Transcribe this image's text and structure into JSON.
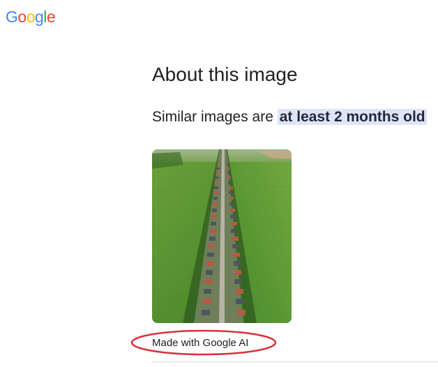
{
  "logo": {
    "letters": [
      {
        "char": "G",
        "color": "#4285F4"
      },
      {
        "char": "o",
        "color": "#EA4335"
      },
      {
        "char": "o",
        "color": "#FBBC05"
      },
      {
        "char": "g",
        "color": "#4285F4"
      },
      {
        "char": "l",
        "color": "#34A853"
      },
      {
        "char": "e",
        "color": "#EA4335"
      }
    ]
  },
  "page": {
    "title": "About this image",
    "similar_prefix": "Similar images are ",
    "similar_highlight": "at least 2 months old",
    "ai_label": "Made with Google AI"
  },
  "image": {
    "icon": "aerial-village-photo",
    "alt": "Aerial view of a long straight road lined with houses through green fields"
  },
  "colors": {
    "text": "#202124",
    "highlight_bg": "#dde6f8",
    "annotation_red": "#d9303a",
    "divider": "#dadce0"
  }
}
